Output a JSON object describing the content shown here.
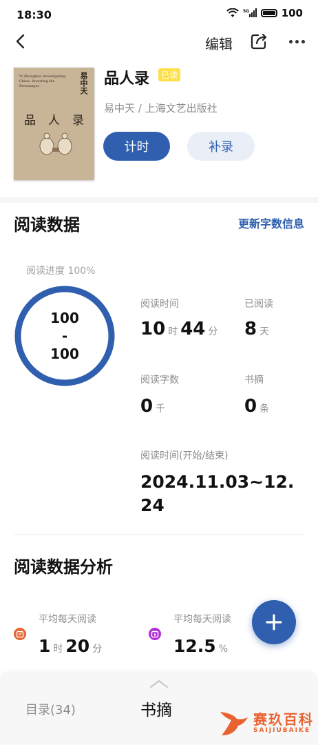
{
  "status_bar": {
    "time": "18:30",
    "battery": "100"
  },
  "nav": {
    "edit_label": "编辑"
  },
  "book": {
    "title": "品人录",
    "badge": "已读",
    "meta": "易中天 / 上海文艺出版社",
    "cover": {
      "side_text": "易中天",
      "en_text": "Yi Zhongtian Investigating China: Investing the Personages",
      "big_chars": [
        "品",
        "人",
        "录"
      ]
    }
  },
  "actions": {
    "timer_label": "计时",
    "supplement_label": "补录"
  },
  "reading_data": {
    "title": "阅读数据",
    "update_link": "更新字数信息",
    "progress_label": "阅读进度 100%",
    "progress_value": 100,
    "ring": {
      "top": "100",
      "mid": "-",
      "bottom": "100"
    },
    "time": {
      "label": "阅读时间",
      "hours": "10",
      "hours_unit": "时",
      "minutes": "44",
      "minutes_unit": "分"
    },
    "days": {
      "label": "已阅读",
      "value": "8",
      "unit": "天"
    },
    "words": {
      "label": "阅读字数",
      "value": "0",
      "unit": "千"
    },
    "excerpts": {
      "label": "书摘",
      "value": "0",
      "unit": "条"
    },
    "range": {
      "label": "阅读时间(开始/结束)",
      "value": "2024.11.03~12.24"
    }
  },
  "analysis": {
    "title": "阅读数据分析",
    "avg_time": {
      "label": "平均每天阅读",
      "hours": "1",
      "hours_unit": "时",
      "minutes": "20",
      "minutes_unit": "分"
    },
    "avg_percent": {
      "label": "平均每天阅读",
      "value": "12.5",
      "unit": "%"
    }
  },
  "bottom_tabs": {
    "toc": "目录(34)",
    "notes": "书摘"
  },
  "watermark": {
    "cn": "赛玖百科",
    "en": "SAIJIUBAIKE"
  },
  "colors": {
    "accent": "#2f5fae",
    "badge": "#fde04a",
    "icon_orange": "#e8632f",
    "icon_purple": "#b12fd4"
  }
}
